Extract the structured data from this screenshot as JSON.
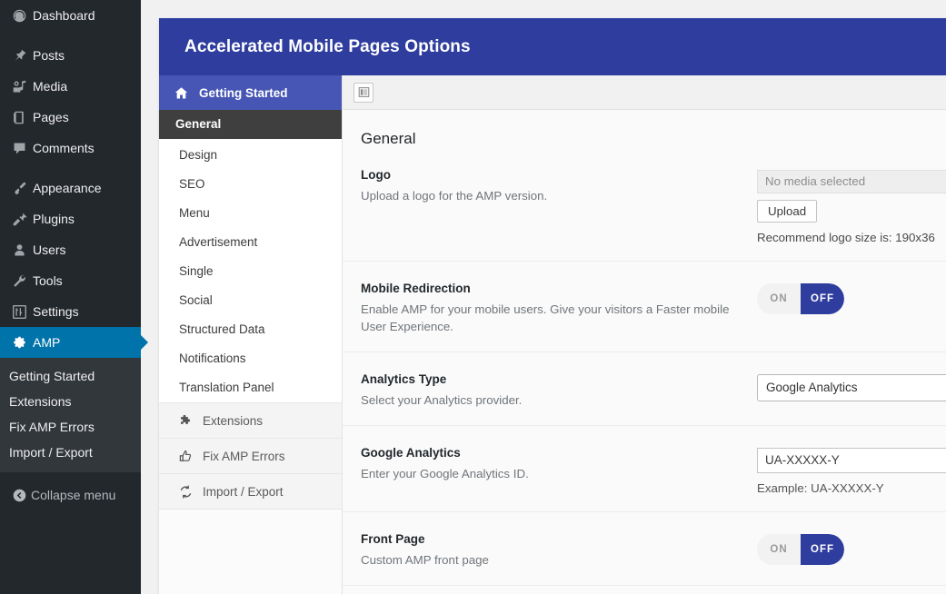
{
  "wp_sidebar": {
    "items": [
      {
        "label": "Dashboard",
        "icon": "dashboard-icon"
      },
      {
        "label": "Posts",
        "icon": "pin-icon"
      },
      {
        "label": "Media",
        "icon": "media-icon"
      },
      {
        "label": "Pages",
        "icon": "page-icon"
      },
      {
        "label": "Comments",
        "icon": "comment-icon"
      },
      {
        "label": "Appearance",
        "icon": "brush-icon"
      },
      {
        "label": "Plugins",
        "icon": "plug-icon"
      },
      {
        "label": "Users",
        "icon": "user-icon"
      },
      {
        "label": "Tools",
        "icon": "wrench-icon"
      },
      {
        "label": "Settings",
        "icon": "sliders-icon"
      },
      {
        "label": "AMP",
        "icon": "gear-icon"
      }
    ],
    "submenu": [
      "Getting Started",
      "Extensions",
      "Fix AMP Errors",
      "Import / Export"
    ],
    "collapse_label": "Collapse menu"
  },
  "header": {
    "title": "Accelerated Mobile Pages Options"
  },
  "nav": {
    "head": {
      "label": "Getting Started",
      "icon": "home-icon"
    },
    "items": [
      "General",
      "Design",
      "SEO",
      "Menu",
      "Advertisement",
      "Single",
      "Social",
      "Structured Data",
      "Notifications",
      "Translation Panel"
    ],
    "active": "General",
    "footer": [
      {
        "label": "Extensions",
        "icon": "puzzle-icon"
      },
      {
        "label": "Fix AMP Errors",
        "icon": "thumbs-up-icon"
      },
      {
        "label": "Import / Export",
        "icon": "sync-icon"
      }
    ]
  },
  "toolbar": {
    "layout_toggle": "layout-toggle-icon"
  },
  "panel": {
    "title": "General",
    "rows": [
      {
        "label": "Logo",
        "desc": "Upload a logo for the AMP version.",
        "control": "media",
        "media_placeholder": "No media selected",
        "upload_label": "Upload",
        "hint": "Recommend logo size is: 190x36"
      },
      {
        "label": "Mobile Redirection",
        "desc": "Enable AMP for your mobile users. Give your visitors a Faster mobile User Experience.",
        "control": "toggle",
        "on_label": "ON",
        "off_label": "OFF",
        "state": "OFF"
      },
      {
        "label": "Analytics Type",
        "desc": "Select your Analytics provider.",
        "control": "select",
        "value": "Google Analytics"
      },
      {
        "label": "Google Analytics",
        "desc": "Enter your Google Analytics ID.",
        "control": "text",
        "value": "UA-XXXXX-Y",
        "hint": "Example: UA-XXXXX-Y"
      },
      {
        "label": "Front Page",
        "desc": "Custom AMP front page",
        "control": "toggle",
        "on_label": "ON",
        "off_label": "OFF",
        "state": "OFF"
      }
    ]
  },
  "colors": {
    "header_blue": "#2f3d9e",
    "nav_head_blue": "#4756b5",
    "wp_current_blue": "#0073aa",
    "wp_sidebar_bg": "#23282d",
    "active_item_gray": "#3f3f3f"
  }
}
